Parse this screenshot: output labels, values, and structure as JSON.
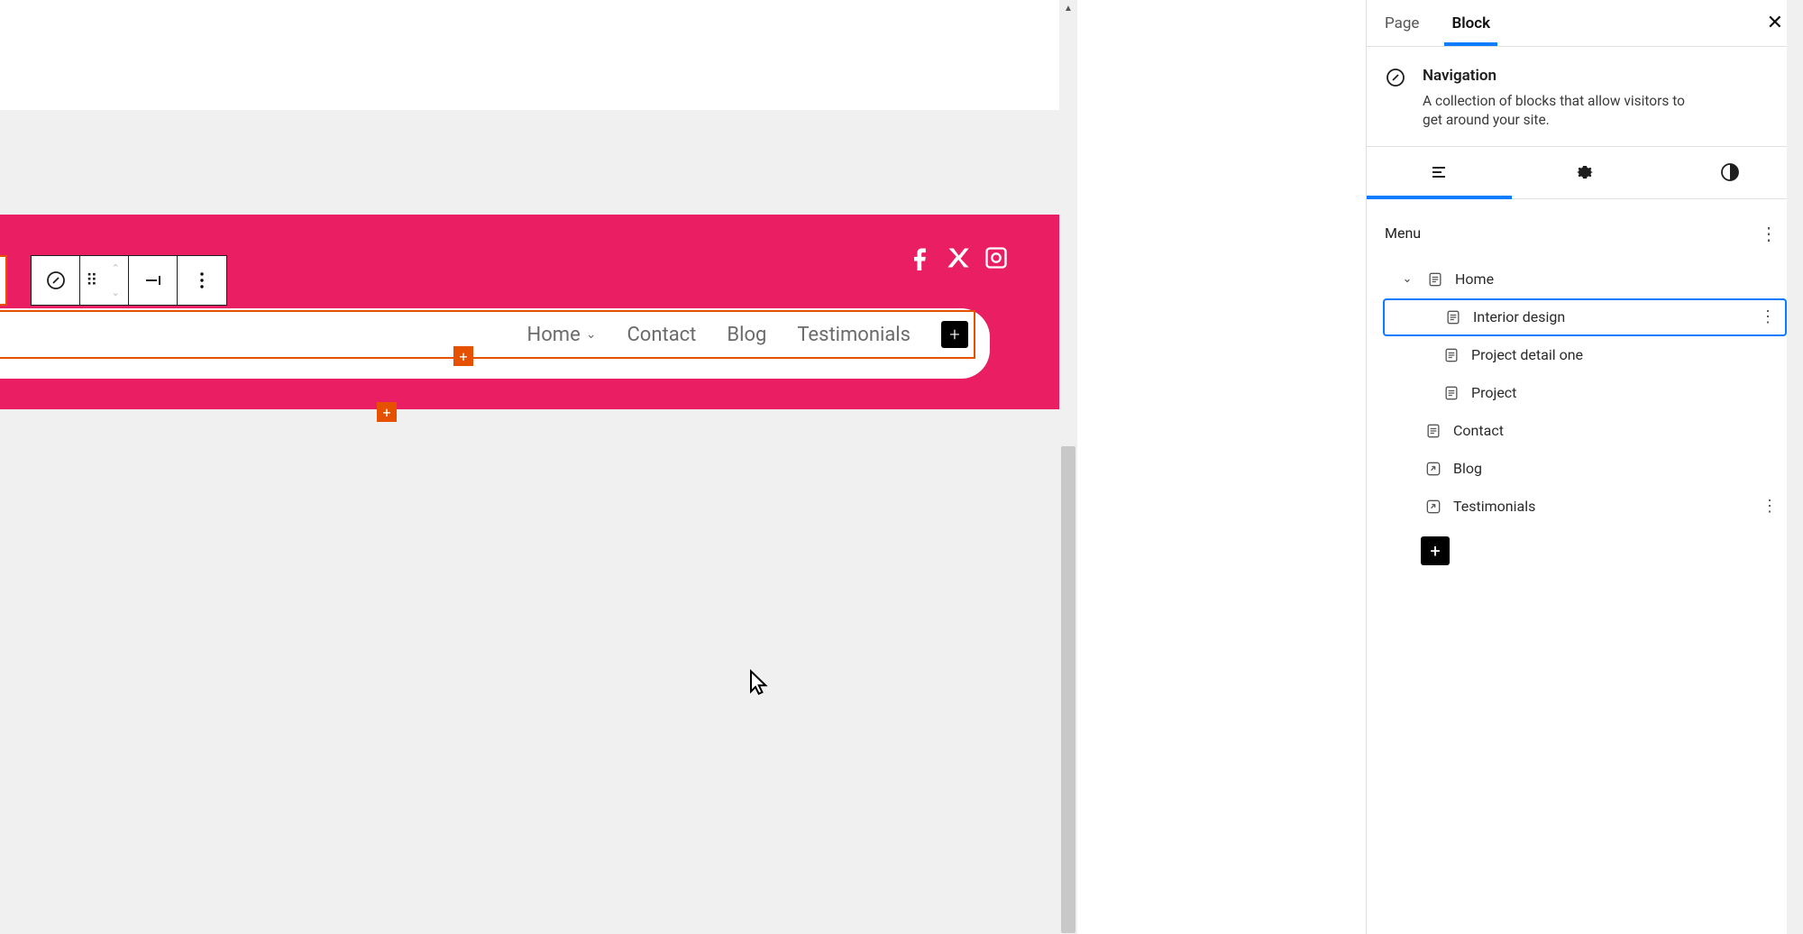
{
  "sidebar": {
    "pageTab": "Page",
    "blockTab": "Block",
    "activeTab": "Block",
    "block": {
      "name": "Navigation",
      "description": "A collection of blocks that allow visitors to get around your site."
    },
    "menuLabel": "Menu",
    "tree": {
      "home": "Home",
      "interior": "Interior design",
      "projectDetail": "Project detail one",
      "project": "Project",
      "contact": "Contact",
      "blog": "Blog",
      "testimonials": "Testimonials"
    }
  },
  "nav": {
    "home": "Home",
    "contact": "Contact",
    "blog": "Blog",
    "testimonials": "Testimonials"
  },
  "colors": {
    "accent": "#e91e63",
    "selection": "#e65100",
    "link": "#0a7cff"
  }
}
